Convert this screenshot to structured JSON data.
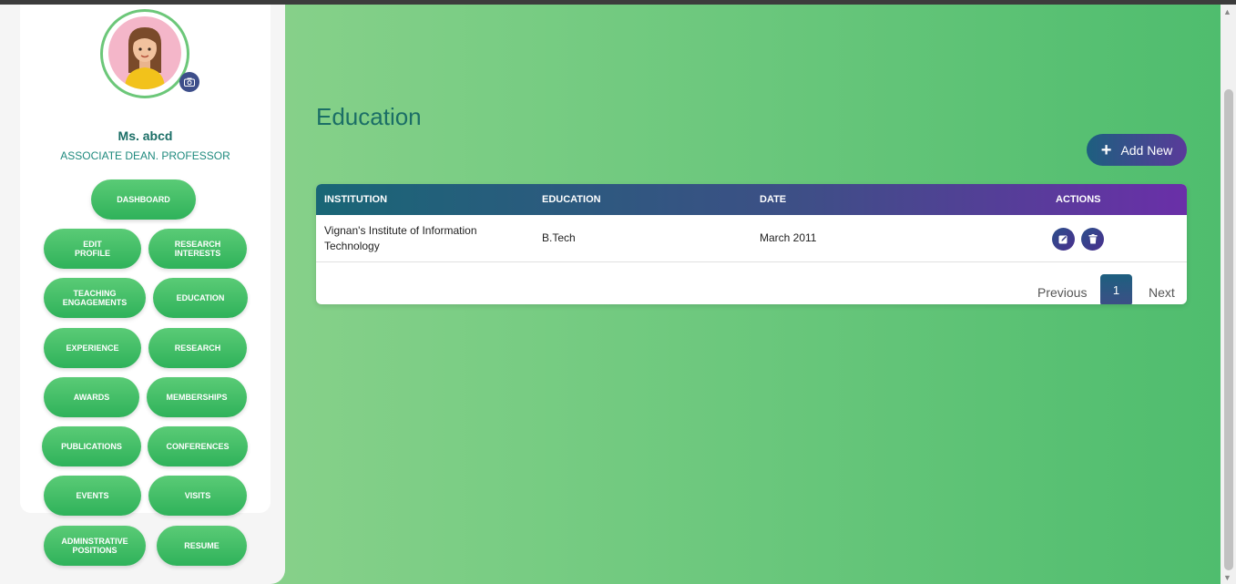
{
  "profile": {
    "name": "Ms. abcd",
    "role": "ASSOCIATE DEAN. PROFESSOR"
  },
  "sidebar": {
    "dashboard": "DASHBOARD",
    "items": [
      {
        "label": "EDIT\nPROFILE"
      },
      {
        "label": "RESEARCH\nINTERESTS"
      },
      {
        "label": "TEACHING\nENGAGEMENTS"
      },
      {
        "label": "EDUCATION"
      },
      {
        "label": "EXPERIENCE"
      },
      {
        "label": "RESEARCH"
      },
      {
        "label": "AWARDS"
      },
      {
        "label": "MEMBERSHIPS"
      },
      {
        "label": "PUBLICATIONS"
      },
      {
        "label": "CONFERENCES"
      },
      {
        "label": "EVENTS"
      },
      {
        "label": "VISITS"
      },
      {
        "label": "ADMINSTRATIVE\nPOSITIONS"
      },
      {
        "label": "RESUME"
      }
    ]
  },
  "main": {
    "title": "Education",
    "add_button": "Add New",
    "table": {
      "columns": [
        "INSTITUTION",
        "EDUCATION",
        "DATE",
        "ACTIONS"
      ],
      "rows": [
        {
          "institution": "Vignan's Institute of Information Technology",
          "education": "B.Tech",
          "date": "March 2011"
        }
      ]
    },
    "pagination": {
      "previous": "Previous",
      "current": "1",
      "next": "Next"
    }
  },
  "colors": {
    "accent_green": "#2fb25a",
    "heading_teal": "#1b6e66",
    "header_gradient_start": "#196676",
    "header_gradient_end": "#6a2fa8"
  },
  "icons": [
    "camera-icon",
    "plus-icon",
    "edit-icon",
    "trash-icon"
  ]
}
